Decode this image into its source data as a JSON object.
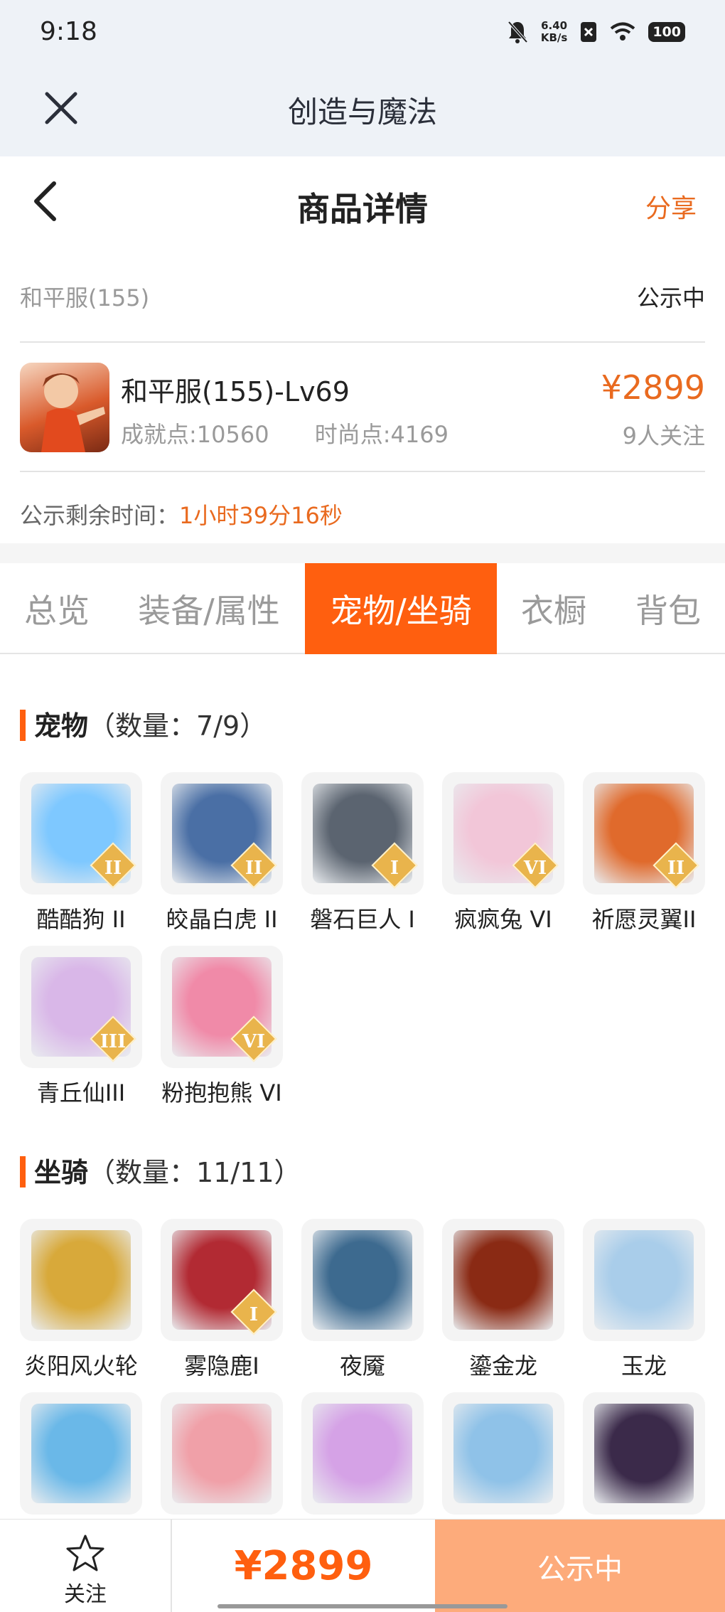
{
  "status_bar": {
    "time": "9:18",
    "net_speed_value": "6.40",
    "net_speed_unit": "KB/s",
    "battery": "100"
  },
  "app_header": {
    "title": "创造与魔法"
  },
  "nav": {
    "title": "商品详情",
    "share_label": "分享"
  },
  "listing": {
    "server": "和平服(155)",
    "status": "公示中",
    "character": "和平服(155)-Lv69",
    "achievement": "成就点:10560",
    "fashion": "时尚点:4169",
    "price": "¥2899",
    "followers": "9人关注",
    "countdown_label": "公示剩余时间：",
    "countdown_value": "1小时39分16秒"
  },
  "tabs": [
    {
      "label": "总览",
      "active": false
    },
    {
      "label": "装备/属性",
      "active": false
    },
    {
      "label": "宠物/坐骑",
      "active": true
    },
    {
      "label": "衣橱",
      "active": false
    },
    {
      "label": "背包",
      "active": false
    }
  ],
  "pets": {
    "title": "宠物",
    "count": "（数量：7/9）",
    "items": [
      {
        "name": "酷酷狗 II",
        "rank": "II",
        "color": "#7ec8ff"
      },
      {
        "name": "皎晶白虎 II",
        "rank": "II",
        "color": "#4a6fa5"
      },
      {
        "name": "磐石巨人 I",
        "rank": "I",
        "color": "#5b6470"
      },
      {
        "name": "疯疯兔 VI",
        "rank": "VI",
        "color": "#f2c6d8"
      },
      {
        "name": "祈愿灵翼II",
        "rank": "II",
        "color": "#e06a2c"
      },
      {
        "name": "青丘仙III",
        "rank": "III",
        "color": "#d9b7e8"
      },
      {
        "name": "粉抱抱熊 VI",
        "rank": "VI",
        "color": "#f08aa8"
      }
    ]
  },
  "mounts": {
    "title": "坐骑",
    "count": "（数量：11/11）",
    "items": [
      {
        "name": "炎阳风火轮",
        "rank": "",
        "color": "#d8a93a"
      },
      {
        "name": "雾隐鹿I",
        "rank": "I",
        "color": "#b22a33"
      },
      {
        "name": "夜魇",
        "rank": "",
        "color": "#3d6a8f"
      },
      {
        "name": "鎏金龙",
        "rank": "",
        "color": "#8a2a14"
      },
      {
        "name": "玉龙",
        "rank": "",
        "color": "#a9cdea"
      },
      {
        "name": "",
        "rank": "",
        "color": "#6ab8e8"
      },
      {
        "name": "",
        "rank": "",
        "color": "#f0a0a8"
      },
      {
        "name": "",
        "rank": "",
        "color": "#d5a2e6"
      },
      {
        "name": "",
        "rank": "",
        "color": "#8fc2e8"
      },
      {
        "name": "",
        "rank": "",
        "color": "#3b2a4a"
      }
    ]
  },
  "bottom_bar": {
    "follow_label": "关注",
    "price": "¥2899",
    "status": "公示中"
  }
}
